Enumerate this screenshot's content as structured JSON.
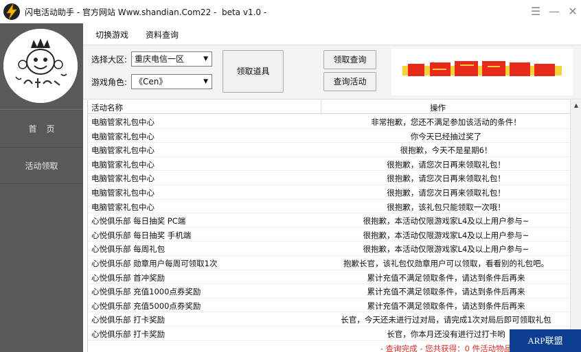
{
  "titlebar": {
    "title": "闪电活动助手 - 官方网站 Www.shandian.Com22 -  beta v1.0 -",
    "menu_glyph": "☰",
    "min_glyph": "—",
    "close_glyph": "✕"
  },
  "sidebar": {
    "items": [
      {
        "label": "首页"
      },
      {
        "label": "活动领取"
      }
    ]
  },
  "topnav": {
    "tabs": [
      {
        "label": "切换游戏"
      },
      {
        "label": "资料查询"
      }
    ]
  },
  "controls": {
    "zone_label": "选择大区:",
    "zone_value": "重庆电信一区",
    "role_label": "游戏角色:",
    "role_value": "《Cen》",
    "claim_button": "领取道具",
    "query_button": "领取查询",
    "activity_button": "查询活动",
    "dropdown_arrow": "▼"
  },
  "table": {
    "headers": {
      "name": "活动名称",
      "op": "操作"
    },
    "rows": [
      {
        "name": "电脑管家礼包中心",
        "op": "非常抱歉，您还不满足参加该活动的条件！"
      },
      {
        "name": "电脑管家礼包中心",
        "op": "你今天已经抽过奖了"
      },
      {
        "name": "电脑管家礼包中心",
        "op": "很抱歉，今天不是星期6！"
      },
      {
        "name": "电脑管家礼包中心",
        "op": "很抱歉，请您次日再来领取礼包！"
      },
      {
        "name": "电脑管家礼包中心",
        "op": "很抱歉，请您次日再来领取礼包！"
      },
      {
        "name": "电脑管家礼包中心",
        "op": "很抱歉，请您次日再来领取礼包！"
      },
      {
        "name": "电脑管家礼包中心",
        "op": "很抱歉，该礼包只能领取一次哦！"
      },
      {
        "name": "心悦俱乐部 每日抽奖 PC端",
        "op": "很抱歉，本活动仅限游戏家L4及以上用户参与~"
      },
      {
        "name": "心悦俱乐部 每日抽奖 手机端",
        "op": "很抱歉，本活动仅限游戏家L4及以上用户参与~"
      },
      {
        "name": "心悦俱乐部 每周礼包",
        "op": "很抱歉，本活动仅限游戏家L4及以上用户参与~"
      },
      {
        "name": "心悦俱乐部 勋章用户每周可领取1次",
        "op": "抱歉长官，该礼包仅勋章用户可以领取，看看别的礼包吧。"
      },
      {
        "name": "心悦俱乐部 首冲奖励",
        "op": "累计充值不满足领取条件，请达到条件后再来"
      },
      {
        "name": "心悦俱乐部 充值1000点券奖励",
        "op": "累计充值不满足领取条件，请达到条件后再来"
      },
      {
        "name": "心悦俱乐部 充值5000点券奖励",
        "op": "累计充值不满足领取条件，请达到条件后再来"
      },
      {
        "name": "心悦俱乐部 打卡奖励",
        "op": "长官，今天还未进行过对局，请完成1次对局后即可领取礼包"
      },
      {
        "name": "心悦俱乐部 打卡奖励",
        "op": "长官，你本月还没有进行过打卡哟"
      },
      {
        "name": "",
        "op": "- 查询完成 - 您共获得：0 件活动物品"
      }
    ]
  },
  "watermark": "ARP联盟 arpun.com",
  "colors": {
    "sidebar_bg": "#595959",
    "result_red": "#d9302a",
    "watermark_bg": "#0b3d91"
  }
}
